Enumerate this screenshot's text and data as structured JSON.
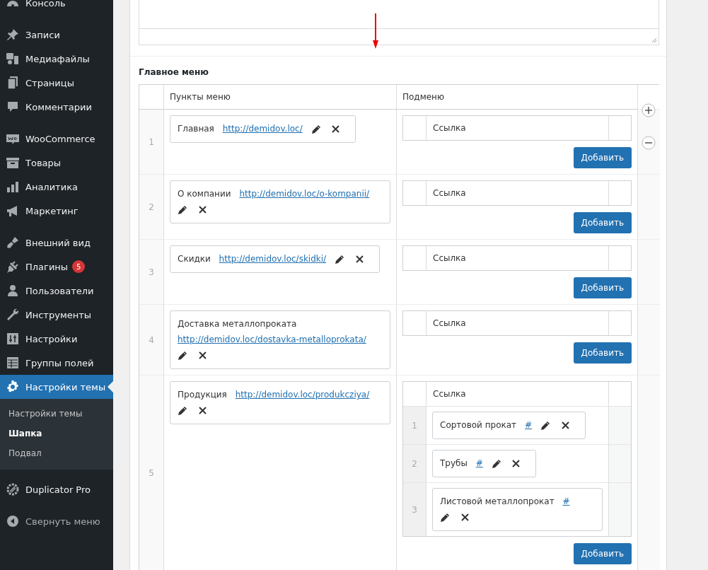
{
  "sidebar": {
    "groups": [
      [
        {
          "label": "Консоль",
          "selected": false
        }
      ],
      [
        {
          "label": "Записи",
          "selected": false
        },
        {
          "label": "Медиафайлы",
          "selected": false
        },
        {
          "label": "Страницы",
          "selected": false
        },
        {
          "label": "Комментарии",
          "selected": false
        }
      ],
      [
        {
          "label": "WooCommerce",
          "selected": false
        },
        {
          "label": "Товары",
          "selected": false
        },
        {
          "label": "Аналитика",
          "selected": false
        },
        {
          "label": "Маркетинг",
          "selected": false
        }
      ],
      [
        {
          "label": "Внешний вид",
          "selected": false
        },
        {
          "label": "Плагины",
          "selected": false,
          "badge": "5"
        },
        {
          "label": "Пользователи",
          "selected": false
        },
        {
          "label": "Инструменты",
          "selected": false
        },
        {
          "label": "Настройки",
          "selected": false
        },
        {
          "label": "Группы полей",
          "selected": false
        },
        {
          "label": "Настройки темы",
          "selected": true,
          "children": [
            {
              "label": "Настройки темы",
              "selected": false
            },
            {
              "label": "Шапка",
              "selected": true
            },
            {
              "label": "Подвал",
              "selected": false
            }
          ]
        }
      ],
      [
        {
          "label": "Duplicator Pro",
          "selected": false
        }
      ]
    ],
    "collapse_label": "Свернуть меню"
  },
  "section": {
    "title": "Главное меню",
    "columns": [
      "Пункты меню",
      "Подменю"
    ],
    "rows": [
      {
        "number": "1",
        "label": "Главная",
        "url": "http://demidov.loc/",
        "submenu": {
          "column": "Ссылка"
        },
        "add_label": "Добавить"
      },
      {
        "number": "2",
        "label": "О компании",
        "url": "http://demidov.loc/o-kompanii/",
        "submenu": {
          "column": "Ссылка"
        },
        "add_label": "Добавить"
      },
      {
        "number": "3",
        "label": "Скидки",
        "url": "http://demidov.loc/skidki/",
        "submenu": {
          "column": "Ссылка"
        },
        "add_label": "Добавить"
      },
      {
        "number": "4",
        "label": "Доставка металлопроката",
        "url": "http://demidov.loc/dostavka-metalloprokata/",
        "submenu": {
          "column": "Ссылка"
        },
        "add_label": "Добавить"
      },
      {
        "number": "5",
        "label": "Продукция",
        "url": "http://demidov.loc/produkcziya/",
        "submenu": {
          "column": "Ссылка",
          "rows": [
            {
              "number": "1",
              "label": "Сортовой прокат",
              "url": "#"
            },
            {
              "number": "2",
              "label": "Трубы",
              "url": "#"
            },
            {
              "number": "3",
              "label": "Листовой металлопрокат",
              "url": "#"
            }
          ]
        },
        "add_label": "Добавить"
      }
    ]
  }
}
